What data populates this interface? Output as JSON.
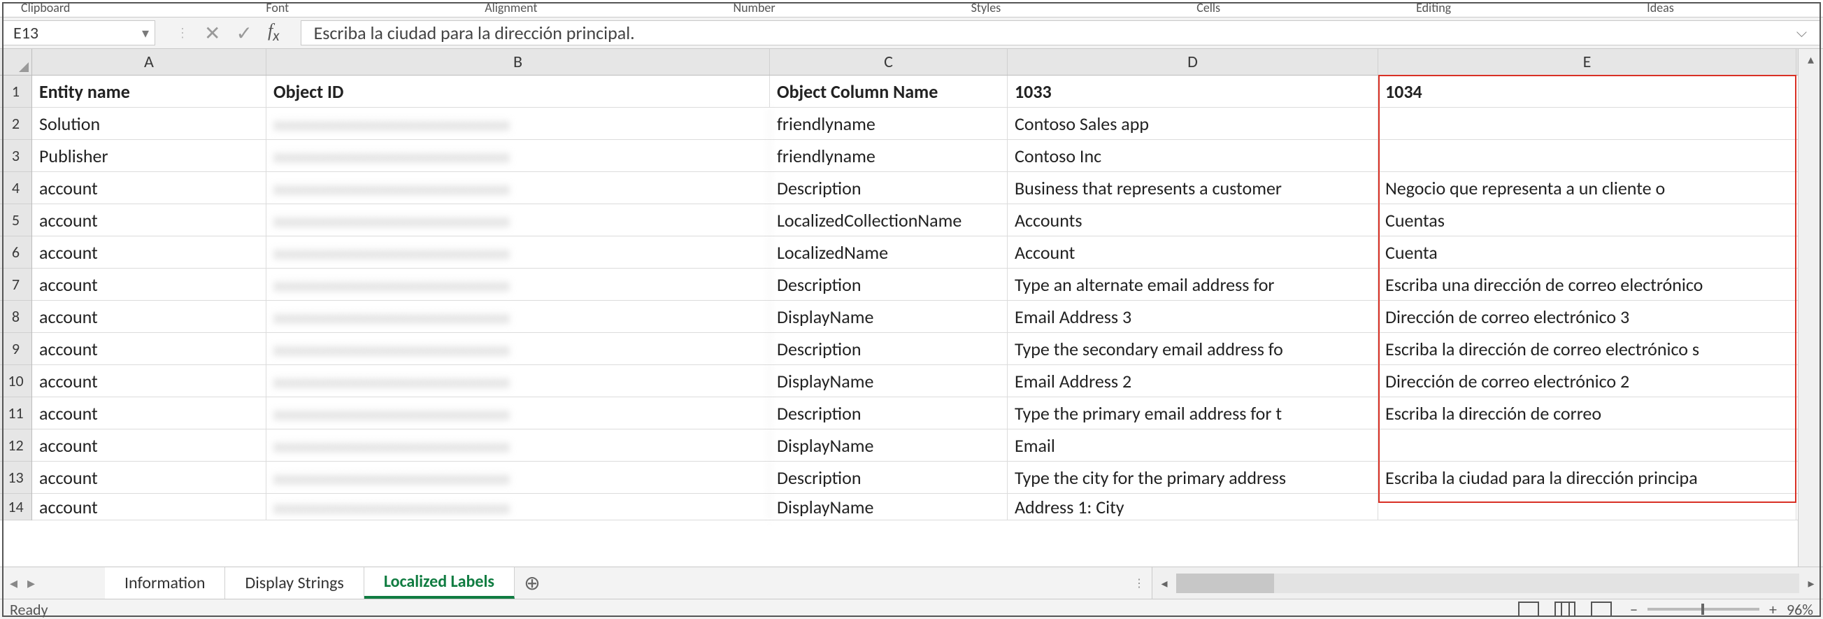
{
  "ribbon_labels": [
    "Clipboard",
    "Font",
    "",
    "Alignment",
    "",
    "Number",
    "",
    "Styles",
    "",
    "Cells",
    "",
    "Editing",
    "",
    "Ideas"
  ],
  "name_box": "E13",
  "formula": "Escriba la ciudad para la dirección principal.",
  "columns": [
    "A",
    "B",
    "C",
    "D",
    "E"
  ],
  "row_numbers": [
    "1",
    "2",
    "3",
    "4",
    "5",
    "6",
    "7",
    "8",
    "9",
    "10",
    "11",
    "12",
    "13",
    "14"
  ],
  "headers": {
    "A": "Entity name",
    "B": "Object ID",
    "C": "Object Column Name",
    "D": "1033",
    "E": "1034"
  },
  "rows": [
    {
      "A": "Solution",
      "B": "",
      "C": "friendlyname",
      "D": "Contoso Sales app",
      "E": ""
    },
    {
      "A": "Publisher",
      "B": "",
      "C": "friendlyname",
      "D": "Contoso Inc",
      "E": ""
    },
    {
      "A": "account",
      "B": "",
      "C": "Description",
      "D": "Business that represents a customer",
      "E": "Negocio que representa a un cliente o"
    },
    {
      "A": "account",
      "B": "",
      "C": "LocalizedCollectionName",
      "D": "Accounts",
      "E": "Cuentas"
    },
    {
      "A": "account",
      "B": "",
      "C": "LocalizedName",
      "D": "Account",
      "E": "Cuenta"
    },
    {
      "A": "account",
      "B": "",
      "C": "Description",
      "D": "Type an alternate email address for",
      "E": "Escriba una dirección de correo electrónico"
    },
    {
      "A": "account",
      "B": "",
      "C": "DisplayName",
      "D": "Email Address 3",
      "E": "Dirección de correo electrónico 3"
    },
    {
      "A": "account",
      "B": "",
      "C": "Description",
      "D": "Type the secondary email address fo",
      "E": "Escriba la dirección de correo electrónico s"
    },
    {
      "A": "account",
      "B": "",
      "C": "DisplayName",
      "D": "Email Address 2",
      "E": "Dirección de correo electrónico 2"
    },
    {
      "A": "account",
      "B": "",
      "C": "Description",
      "D": "Type the primary email address for t",
      "E": "Escriba la dirección de correo"
    },
    {
      "A": "account",
      "B": "",
      "C": "DisplayName",
      "D": "Email",
      "E": ""
    },
    {
      "A": "account",
      "B": "",
      "C": "Description",
      "D": "Type the city for the primary address",
      "E": "Escriba la ciudad para la dirección principa"
    },
    {
      "A": "account",
      "B": "",
      "C": "DisplayName",
      "D": "Address 1: City",
      "E": ""
    }
  ],
  "tabs": [
    "Information",
    "Display Strings",
    "Localized Labels"
  ],
  "active_tab": 2,
  "status": "Ready",
  "zoom": "96%"
}
